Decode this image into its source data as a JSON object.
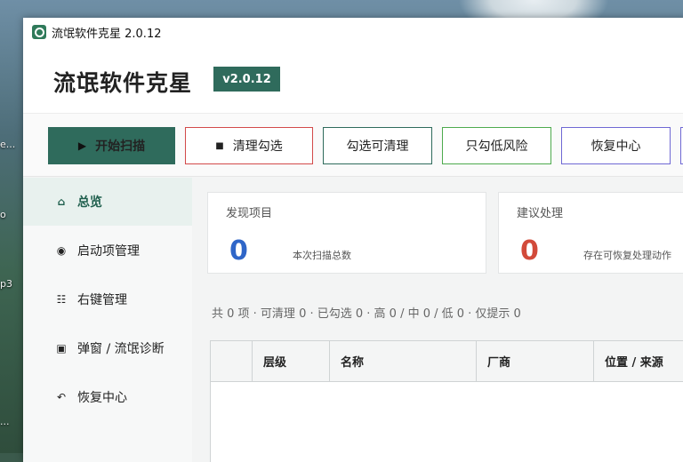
{
  "desktop": {
    "labels": [
      "e...",
      "o",
      "p3",
      "..."
    ]
  },
  "window": {
    "title": "流氓软件克星 2.0.12"
  },
  "header": {
    "app_name": "流氓软件克星",
    "version": "v2.0.12"
  },
  "toolbar": {
    "start_scan": "开始扫描",
    "clean_selected": "清理勾选",
    "select_cleanable": "勾选可清理",
    "select_low_risk": "只勾低风险",
    "restore_center": "恢复中心"
  },
  "sidebar": {
    "items": [
      {
        "label": "总览",
        "icon": "home-icon",
        "active": true
      },
      {
        "label": "启动项管理",
        "icon": "startup-icon",
        "active": false
      },
      {
        "label": "右键管理",
        "icon": "list-icon",
        "active": false
      },
      {
        "label": "弹窗 / 流氓诊断",
        "icon": "popup-icon",
        "active": false
      },
      {
        "label": "恢复中心",
        "icon": "restore-icon",
        "active": false
      }
    ]
  },
  "cards": [
    {
      "title": "发现项目",
      "value": "0",
      "desc": "本次扫描总数"
    },
    {
      "title": "建议处理",
      "value": "0",
      "desc": "存在可恢复处理动作"
    }
  ],
  "summary": "共 0 项 · 可清理 0 · 已勾选 0 · 高 0 / 中 0 / 低 0 · 仅提示 0",
  "table": {
    "columns": [
      "",
      "层级",
      "名称",
      "厂商",
      "位置 / 来源"
    ]
  },
  "colors": {
    "accent": "#2f6b5c",
    "danger": "#d24a4a",
    "success": "#4daa4d",
    "info": "#6f68d4",
    "number_blue": "#2f66c8",
    "number_red": "#d24a3a"
  }
}
